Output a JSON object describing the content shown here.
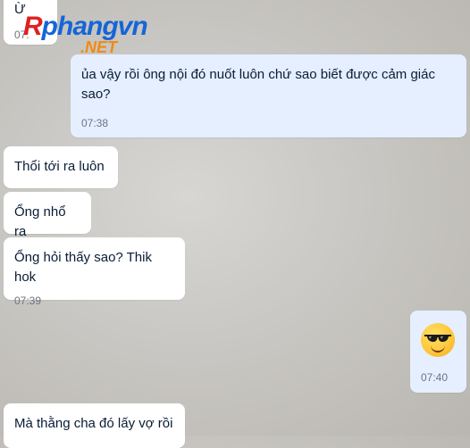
{
  "messages": [
    {
      "text": "Ừ",
      "time": "07:"
    },
    {
      "text": "ủa vậy rồi ông nội đó nuốt luôn chứ sao biết được cảm giác sao?",
      "time": "07:38"
    },
    {
      "text": "Thổi tới ra luôn"
    },
    {
      "text": "Ổng nhổ ra"
    },
    {
      "text": "Ổng hỏi thấy sao? Thik hok",
      "time": "07:39"
    },
    {
      "emoji": "sunglasses-face",
      "time": "07:40"
    },
    {
      "text": "Mà thằng cha đó lấy vợ rồi"
    }
  ],
  "watermark": {
    "main_r": "R",
    "main_rest": "phangvn",
    "sub": ".NET"
  },
  "colors": {
    "incoming_bubble": "#ffffff",
    "outgoing_bubble": "#e5efff",
    "text": "#081c36",
    "time": "#6b7480"
  }
}
